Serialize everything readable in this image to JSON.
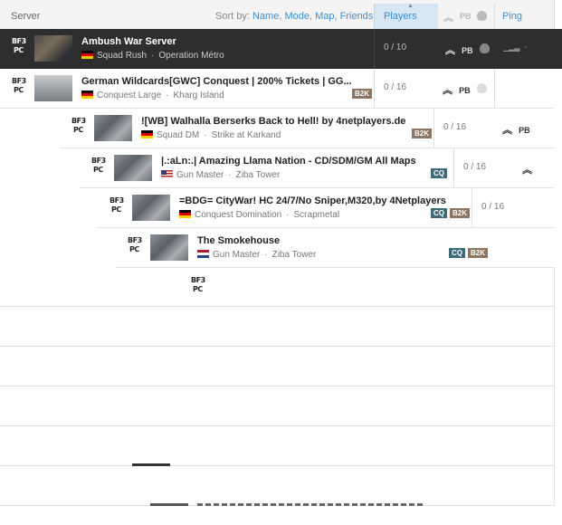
{
  "header": {
    "server_label": "Server",
    "sort_prefix": "Sort by:",
    "sort_links": [
      "Name",
      "Mode",
      "Map",
      "Friends"
    ],
    "players_label": "Players",
    "ping_label": "Ping"
  },
  "rows": [
    {
      "platform_top": "BF3",
      "platform_bottom": "PC",
      "title": "Ambush War Server",
      "flag": "de",
      "mode": "Squad Rush",
      "map": "Operation Métro",
      "players": "0 / 10",
      "ping": "-",
      "badges": []
    },
    {
      "platform_top": "BF3",
      "platform_bottom": "PC",
      "title": "German Wildcards[GWC] Conquest | 200% Tickets | GG...",
      "flag": "de",
      "mode": "Conquest Large",
      "map": "Kharg Island",
      "players": "0 / 16",
      "badges": [
        "B2K"
      ]
    },
    {
      "platform_top": "BF3",
      "platform_bottom": "PC",
      "title": "![WB] Walhalla Berserks Back to Hell! by 4netplayers.de",
      "flag": "de",
      "mode": "Squad DM",
      "map": "Strike at Karkand",
      "players": "0 / 16",
      "badges": [
        "B2K"
      ]
    },
    {
      "platform_top": "BF3",
      "platform_bottom": "PC",
      "title": "|.:aLn:.| Amazing Llama Nation - CD/SDM/GM All Maps",
      "flag": "us",
      "mode": "Gun Master",
      "map": "Ziba Tower",
      "players": "0 / 16",
      "badges": [
        "CQ"
      ]
    },
    {
      "platform_top": "BF3",
      "platform_bottom": "PC",
      "title": "=BDG= CityWar! HC 24/7/No Sniper,M320,by 4Netplayers",
      "flag": "de",
      "mode": "Conquest Domination",
      "map": "Scrapmetal",
      "players": "0 / 16",
      "badges": [
        "CQ",
        "B2K"
      ]
    },
    {
      "platform_top": "BF3",
      "platform_bottom": "PC",
      "title": "The Smokehouse",
      "flag": "nl",
      "mode": "Gun Master",
      "map": "Ziba Tower",
      "players": "",
      "badges": [
        "CQ",
        "B2K"
      ]
    },
    {
      "platform_top": "BF3",
      "platform_bottom": "PC"
    }
  ],
  "icons": {
    "rank": "rank-chevron-icon",
    "pb": "punkbuster-icon",
    "hardcore": "skull-icon"
  },
  "pb_label": "PB",
  "colors": {
    "selected_row": "#2e2e2e",
    "link": "#3a8fd0",
    "players_header": "#d6e6f2",
    "b2k_badge": "#8c7562",
    "cq_badge": "#3e6a7a"
  }
}
